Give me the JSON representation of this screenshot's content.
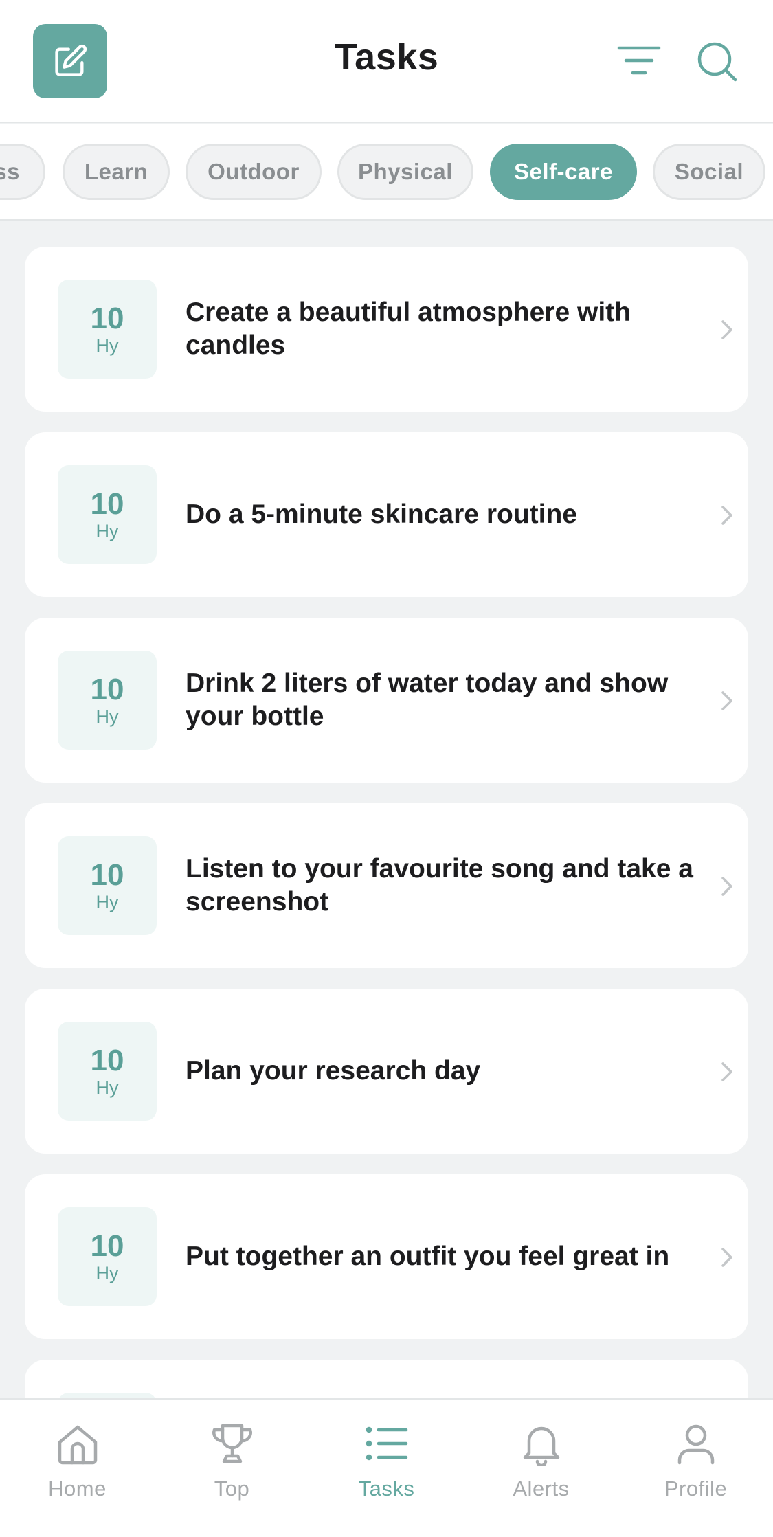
{
  "header": {
    "title": "Tasks",
    "edit_icon": "edit-square-icon",
    "filter_icon": "filter-icon",
    "search_icon": "search-icon"
  },
  "categories": [
    {
      "label": "ss",
      "active": false
    },
    {
      "label": "Learn",
      "active": false
    },
    {
      "label": "Outdoor",
      "active": false
    },
    {
      "label": "Physical",
      "active": false
    },
    {
      "label": "Self-care",
      "active": true
    },
    {
      "label": "Social",
      "active": false
    }
  ],
  "tasks": [
    {
      "points": "10",
      "unit": "Hy",
      "text": "Create a beautiful atmosphere with candles"
    },
    {
      "points": "10",
      "unit": "Hy",
      "text": "Do a 5-minute skincare routine"
    },
    {
      "points": "10",
      "unit": "Hy",
      "text": "Drink 2 liters of water today and show your bottle"
    },
    {
      "points": "10",
      "unit": "Hy",
      "text": "Listen to your favourite song and take a screenshot"
    },
    {
      "points": "10",
      "unit": "Hy",
      "text": "Plan your research day"
    },
    {
      "points": "10",
      "unit": "Hy",
      "text": "Put together an outfit you feel great in"
    },
    {
      "points": "",
      "unit": "",
      "text": ""
    }
  ],
  "tabbar": {
    "home": "Home",
    "top": "Top",
    "tasks": "Tasks",
    "alerts": "Alerts",
    "profile": "Profile",
    "active": "tasks"
  },
  "colors": {
    "accent": "#64a8a0",
    "inactive": "#a7aaac",
    "background": "#f0f2f3"
  }
}
